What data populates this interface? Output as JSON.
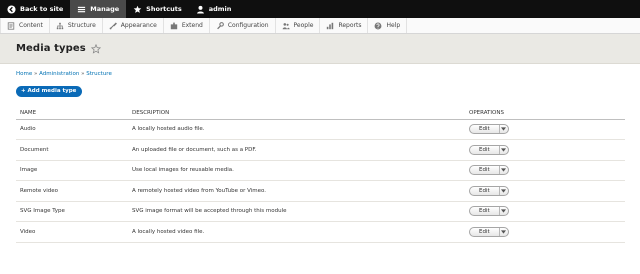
{
  "toolbar": {
    "back_label": "Back to site",
    "manage_label": "Manage",
    "shortcuts_label": "Shortcuts",
    "user_label": "admin"
  },
  "tray": {
    "items": [
      {
        "label": "Content",
        "icon": "content-icon"
      },
      {
        "label": "Structure",
        "icon": "structure-icon"
      },
      {
        "label": "Appearance",
        "icon": "appearance-icon"
      },
      {
        "label": "Extend",
        "icon": "extend-icon"
      },
      {
        "label": "Configuration",
        "icon": "configuration-icon"
      },
      {
        "label": "People",
        "icon": "people-icon"
      },
      {
        "label": "Reports",
        "icon": "reports-icon"
      },
      {
        "label": "Help",
        "icon": "help-icon"
      }
    ]
  },
  "page": {
    "title": "Media types"
  },
  "breadcrumb": {
    "home": "Home",
    "administration": "Administration",
    "structure": "Structure",
    "separator": "»"
  },
  "actions": {
    "add_label": "+ Add media type"
  },
  "table": {
    "headers": {
      "name": "NAME",
      "description": "DESCRIPTION",
      "operations": "OPERATIONS"
    },
    "edit_label": "Edit",
    "rows": [
      {
        "name": "Audio",
        "description": "A locally hosted audio file."
      },
      {
        "name": "Document",
        "description": "An uploaded file or document, such as a PDF."
      },
      {
        "name": "Image",
        "description": "Use local images for reusable media."
      },
      {
        "name": "Remote video",
        "description": "A remotely hosted video from YouTube or Vimeo."
      },
      {
        "name": "SVG Image Type",
        "description": "SVG image format will be accepted through this module"
      },
      {
        "name": "Video",
        "description": "A locally hosted video file."
      }
    ]
  },
  "colors": {
    "toolbar_bg": "#0f0f0f",
    "accent": "#0a6ab7",
    "link": "#0071b3",
    "header_bg": "#eae9e4"
  }
}
